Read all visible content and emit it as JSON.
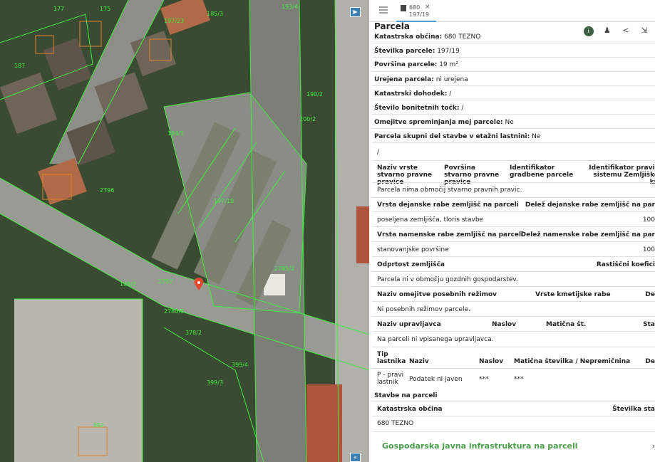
{
  "map": {
    "parcel_labels": [
      "177",
      "175",
      "187",
      "197/23",
      "185/3",
      "193/4",
      "190/2",
      "194/1",
      "197/19",
      "2785/2",
      "188/2",
      "2797",
      "2780/5",
      "378/2",
      "399/3",
      "399/4",
      "392",
      "2796",
      "200/2"
    ]
  },
  "tabbar": {
    "tab_line1": "680",
    "tab_line2": "197/19",
    "tab_close": "×"
  },
  "panel": {
    "title": "Parcela",
    "actions": [
      "info-icon",
      "person-pin-icon",
      "share-icon",
      "export-icon"
    ],
    "fields": [
      {
        "label": "Katastrska občina:",
        "value": "680 TEZNO"
      },
      {
        "label": "Številka parcele:",
        "value": "197/19"
      },
      {
        "label": "Površina parcele:",
        "value": "19 m²"
      },
      {
        "label": "Urejena parcela:",
        "value": "ni urejena"
      },
      {
        "label": "Katastrski dohodek:",
        "value": "/"
      },
      {
        "label": "Število bonitetnih točk:",
        "value": "/"
      },
      {
        "label": "Omejitve spreminjanja mej parcele:",
        "value": "Ne"
      },
      {
        "label": "Parcela skupni del stavbe v etažni lastnini:",
        "value": "Ne"
      }
    ],
    "slash": "/",
    "rights_headers": [
      "Naziv vrste stvarno pravne pravice",
      "Površina stvarno pravne pravice",
      "Identifikator gradbene parcele",
      "Identifikator pravic sistemu Zemljiške kn"
    ],
    "rights_empty": "Parcela nima območij stvarno pravnih pravic.",
    "actual_use_headers": [
      "Vrsta dejanske rabe zemljišč na parceli",
      "Delež dejanske rabe zemljišč na par"
    ],
    "actual_use_row": [
      "poseljena zemljišča, tloris stavbe",
      "100"
    ],
    "intended_use_headers": [
      "Vrsta namenske rabe zemljišč na parceli",
      "Delež namenske rabe zemljišč na par"
    ],
    "intended_use_row": [
      "stanovanjske površine",
      "100"
    ],
    "openness_headers": [
      "Odprtost zemljišča",
      "Rastiščni koefici"
    ],
    "openness_empty": "Parcela ni v območju gozdnih gospodarstev.",
    "regime_headers": [
      "Naziv omejitve posebnih režimov",
      "Vrste kmetijske rabe",
      "De"
    ],
    "regime_empty": "Ni posebnih režimov parcele.",
    "manager_headers": [
      "Naziv upravljavca",
      "Naslov",
      "Matična št.",
      "Sta"
    ],
    "manager_empty": "Na parceli ni vpisanega upravljavca.",
    "owner_headers": [
      "Tip lastnika",
      "Naziv",
      "Naslov",
      "Matična številka / Nepremičnina",
      "De"
    ],
    "owner_row": [
      "P - pravi lastnik",
      "Podatek ni javen",
      "***",
      "***"
    ],
    "buildings_title": "Stavbe na parceli",
    "buildings_headers": [
      "Katastrska občina",
      "Številka sta"
    ],
    "buildings_row": [
      "680 TEZNO"
    ],
    "footer_label": "Gospodarska javna infrastruktura na parceli",
    "footer_chevron": "›"
  }
}
